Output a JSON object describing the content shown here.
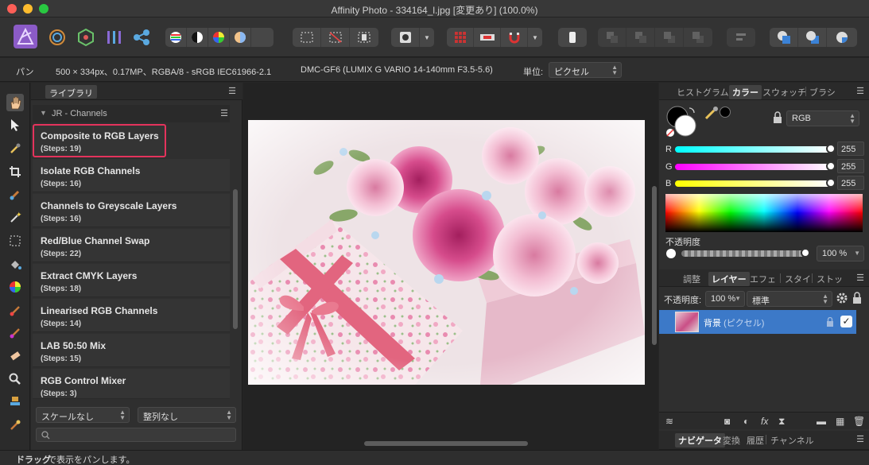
{
  "window": {
    "title": "Affinity Photo - 334164_l.jpg [変更あり] (100.0%)"
  },
  "context_bar": {
    "tool_name": "パン",
    "image_info": "500 × 334px、0.17MP、RGBA/8 - sRGB IEC61966-2.1",
    "camera_info": "DMC-GF6 (LUMIX G VARIO 14-140mm F3.5-5.6)",
    "unit_label": "単位:",
    "unit_value": "ピクセル"
  },
  "library": {
    "tab": "ライブラリ",
    "group": "JR - Channels",
    "macros": [
      {
        "name": "Composite to RGB Layers",
        "steps": "(Steps: 19)"
      },
      {
        "name": "Isolate RGB Channels",
        "steps": "(Steps: 16)"
      },
      {
        "name": "Channels to Greyscale Layers",
        "steps": "(Steps: 16)"
      },
      {
        "name": "Red/Blue Channel Swap",
        "steps": "(Steps: 22)"
      },
      {
        "name": "Extract CMYK Layers",
        "steps": "(Steps: 18)"
      },
      {
        "name": "Linearised RGB Channels",
        "steps": "(Steps: 14)"
      },
      {
        "name": "LAB 50:50 Mix",
        "steps": "(Steps: 15)"
      },
      {
        "name": "RGB Control Mixer",
        "steps": "(Steps: 3)"
      }
    ],
    "scale_select": "スケールなし",
    "align_select": "整列なし"
  },
  "color_panel": {
    "tabs": [
      "ヒストグラム",
      "カラー",
      "スウォッチ",
      "ブラシ"
    ],
    "active_tab": "カラー",
    "model": "RGB",
    "r_label": "R",
    "r_value": "255",
    "g_label": "G",
    "g_value": "255",
    "b_label": "B",
    "b_value": "255",
    "opacity_label": "不透明度",
    "opacity_value": "100 %"
  },
  "layers_panel": {
    "tabs": [
      "調整",
      "レイヤー",
      "エフェ",
      "スタイ",
      "ストッ"
    ],
    "active_tab": "レイヤー",
    "opacity_label": "不透明度:",
    "opacity_value": "100 %",
    "blend_mode": "標準",
    "layer_name": "背景",
    "layer_type": "(ピクセル)"
  },
  "nav_panel": {
    "tabs": [
      "ナビゲータ",
      "変換",
      "履歴",
      "チャンネル"
    ],
    "active_tab": "ナビゲータ"
  },
  "status": {
    "bold": "ドラッグ",
    "rest": "で表示をパンします。"
  }
}
